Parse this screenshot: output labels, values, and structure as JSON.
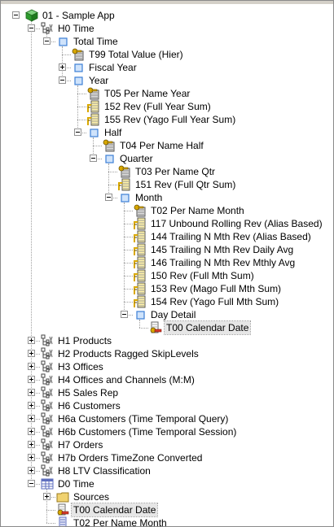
{
  "nodes": [
    {
      "id": "n0",
      "depth": 0,
      "label": "01 - Sample App",
      "icon": "app-cube-icon",
      "expander": "minus"
    },
    {
      "id": "n1",
      "depth": 1,
      "label": "H0 Time",
      "icon": "hierarchy-icon",
      "expander": "minus"
    },
    {
      "id": "n2",
      "depth": 2,
      "label": "Total Time",
      "icon": "level-icon",
      "expander": "minus"
    },
    {
      "id": "n3",
      "depth": 3,
      "label": "T99 Total Value (Hier)",
      "icon": "key-column-icon",
      "expander": "none"
    },
    {
      "id": "n4",
      "depth": 3,
      "label": "Fiscal Year",
      "icon": "level-icon",
      "expander": "plus"
    },
    {
      "id": "n5",
      "depth": 3,
      "label": "Year",
      "icon": "level-icon",
      "expander": "minus"
    },
    {
      "id": "n6",
      "depth": 4,
      "label": "T05 Per Name Year",
      "icon": "key-column-icon",
      "expander": "none"
    },
    {
      "id": "n7",
      "depth": 4,
      "label": "152  Rev  (Full Year Sum)",
      "icon": "measure-column-icon",
      "expander": "none"
    },
    {
      "id": "n8",
      "depth": 4,
      "label": "155  Rev  (Yago Full Year Sum)",
      "icon": "measure-column-icon",
      "expander": "none"
    },
    {
      "id": "n9",
      "depth": 4,
      "label": "Half",
      "icon": "level-icon",
      "expander": "minus"
    },
    {
      "id": "n10",
      "depth": 5,
      "label": "T04 Per Name Half",
      "icon": "key-column-icon",
      "expander": "none"
    },
    {
      "id": "n11",
      "depth": 5,
      "label": "Quarter",
      "icon": "level-icon",
      "expander": "minus"
    },
    {
      "id": "n12",
      "depth": 6,
      "label": "T03 Per Name Qtr",
      "icon": "key-column-icon",
      "expander": "none"
    },
    {
      "id": "n13",
      "depth": 6,
      "label": "151  Rev  (Full Qtr Sum)",
      "icon": "measure-column-icon",
      "expander": "none"
    },
    {
      "id": "n14",
      "depth": 6,
      "label": "Month",
      "icon": "level-icon",
      "expander": "minus"
    },
    {
      "id": "n15",
      "depth": 7,
      "label": "T02 Per Name Month",
      "icon": "key-column-icon",
      "expander": "none"
    },
    {
      "id": "n16",
      "depth": 7,
      "label": "117  Unbound Rolling Rev  (Alias Based)",
      "icon": "measure-column-icon",
      "expander": "none"
    },
    {
      "id": "n17",
      "depth": 7,
      "label": "144  Trailing N Mth Rev  (Alias Based)",
      "icon": "measure-column-icon",
      "expander": "none"
    },
    {
      "id": "n18",
      "depth": 7,
      "label": "145  Trailing N Mth Rev Daily Avg",
      "icon": "measure-column-icon",
      "expander": "none"
    },
    {
      "id": "n19",
      "depth": 7,
      "label": "146  Trailing N Mth Rev Mthly Avg",
      "icon": "measure-column-icon",
      "expander": "none"
    },
    {
      "id": "n20",
      "depth": 7,
      "label": "150  Rev  (Full Mth Sum)",
      "icon": "measure-column-icon",
      "expander": "none"
    },
    {
      "id": "n21",
      "depth": 7,
      "label": "153  Rev  (Mago Full Mth Sum)",
      "icon": "measure-column-icon",
      "expander": "none"
    },
    {
      "id": "n22",
      "depth": 7,
      "label": "154  Rev  (Yago Full Mth Sum)",
      "icon": "measure-column-icon",
      "expander": "none"
    },
    {
      "id": "n23",
      "depth": 7,
      "label": "Day Detail",
      "icon": "level-icon",
      "expander": "minus"
    },
    {
      "id": "n24",
      "depth": 8,
      "label": "T00 Calendar Date",
      "icon": "primary-key-icon",
      "expander": "none",
      "selected": true
    },
    {
      "id": "n25",
      "depth": 1,
      "label": "H1 Products",
      "icon": "hierarchy-icon",
      "expander": "plus"
    },
    {
      "id": "n26",
      "depth": 1,
      "label": "H2 Products Ragged SkipLevels",
      "icon": "hierarchy-icon",
      "expander": "plus"
    },
    {
      "id": "n27",
      "depth": 1,
      "label": "H3 Offices",
      "icon": "hierarchy-icon",
      "expander": "plus"
    },
    {
      "id": "n28",
      "depth": 1,
      "label": "H4 Offices and Channels (M:M)",
      "icon": "hierarchy-icon",
      "expander": "plus"
    },
    {
      "id": "n29",
      "depth": 1,
      "label": "H5 Sales Rep",
      "icon": "hierarchy-icon",
      "expander": "plus"
    },
    {
      "id": "n30",
      "depth": 1,
      "label": "H6 Customers",
      "icon": "hierarchy-icon",
      "expander": "plus"
    },
    {
      "id": "n31",
      "depth": 1,
      "label": "H6a Customers (Time Temporal Query)",
      "icon": "hierarchy-icon",
      "expander": "plus"
    },
    {
      "id": "n32",
      "depth": 1,
      "label": "H6b Customers (Time Temporal Session)",
      "icon": "hierarchy-icon",
      "expander": "plus"
    },
    {
      "id": "n33",
      "depth": 1,
      "label": "H7 Orders",
      "icon": "hierarchy-icon",
      "expander": "plus"
    },
    {
      "id": "n34",
      "depth": 1,
      "label": "H7b Orders TimeZone Converted",
      "icon": "hierarchy-icon",
      "expander": "plus"
    },
    {
      "id": "n35",
      "depth": 1,
      "label": "H8 LTV Classification",
      "icon": "hierarchy-icon",
      "expander": "plus"
    },
    {
      "id": "n36",
      "depth": 1,
      "label": "D0 Time",
      "icon": "table-icon",
      "expander": "minus"
    },
    {
      "id": "n37",
      "depth": 2,
      "label": "Sources",
      "icon": "folder-icon",
      "expander": "plus"
    },
    {
      "id": "n38",
      "depth": 2,
      "label": "T00 Calendar Date",
      "icon": "primary-key-icon",
      "expander": "none",
      "selected": true
    },
    {
      "id": "n39",
      "depth": 2,
      "label": "T02 Per Name Month",
      "icon": "column-icon",
      "expander": "none"
    }
  ],
  "colors": {
    "cube_green": "#2e9b2e",
    "level_blue": "#3c7fd6",
    "key_gold": "#d9a800",
    "table_blue": "#5f6fbf",
    "folder_yellow": "#f0d270",
    "key_red": "#d83b2a",
    "selection": "#e6e6e6"
  }
}
